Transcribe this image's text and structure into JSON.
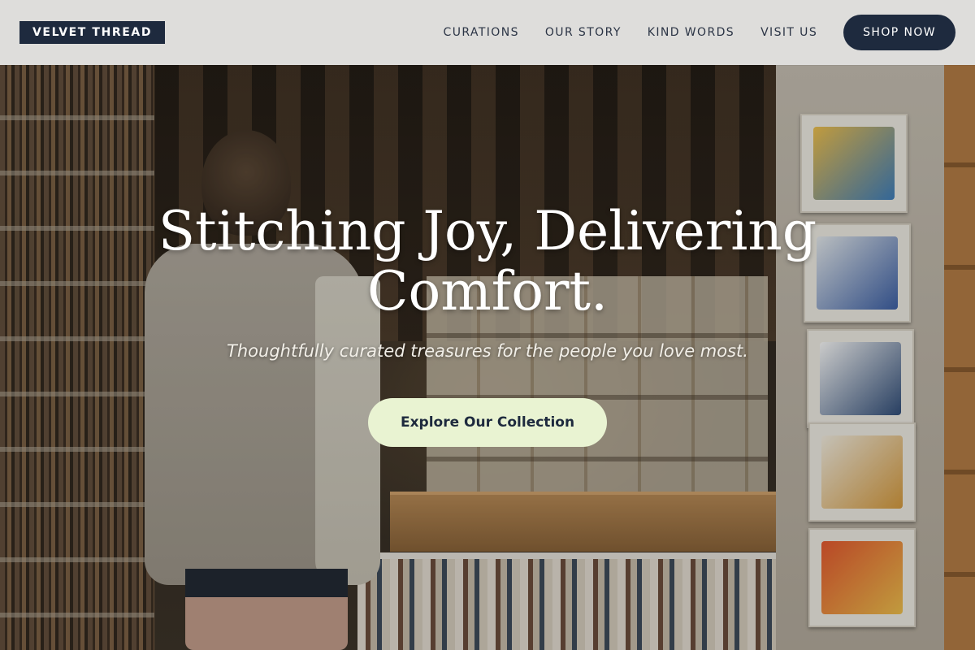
{
  "brand": {
    "logo_text": "VELVET THREAD"
  },
  "nav": {
    "links": [
      {
        "label": "CURATIONS"
      },
      {
        "label": "OUR STORY"
      },
      {
        "label": "KIND WORDS"
      },
      {
        "label": "VISIT US"
      }
    ],
    "shop_button": "SHOP NOW"
  },
  "hero": {
    "title": "Stitching Joy, Delivering Comfort.",
    "subtitle": "Thoughtfully curated treasures for the people you love most.",
    "cta_label": "Explore Our Collection"
  },
  "colors": {
    "navy": "#1e2a3e",
    "cta_background": "#e9f3d2",
    "header_background": "#ececea"
  }
}
